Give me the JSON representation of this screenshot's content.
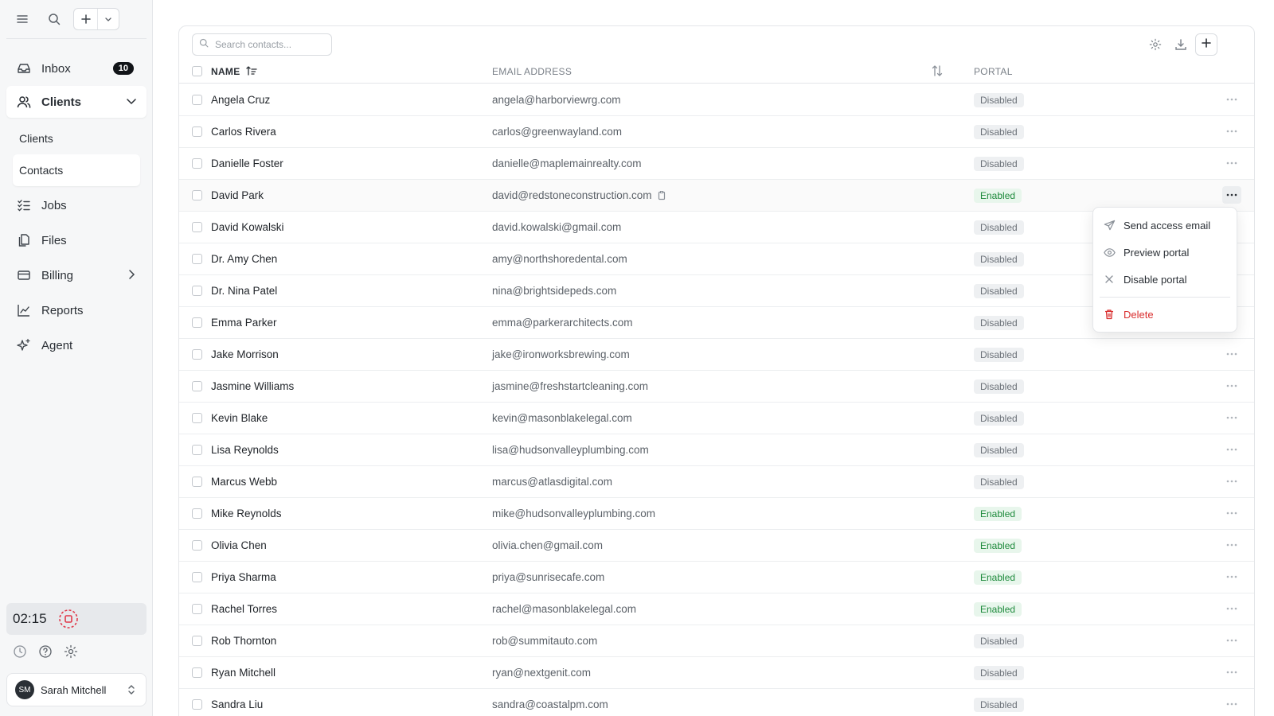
{
  "sidebar": {
    "nav": {
      "inbox": {
        "label": "Inbox",
        "badge": "10"
      },
      "clients": {
        "label": "Clients"
      },
      "clients_sub": {
        "label": "Clients"
      },
      "contacts_sub": {
        "label": "Contacts"
      },
      "jobs": {
        "label": "Jobs"
      },
      "files": {
        "label": "Files"
      },
      "billing": {
        "label": "Billing"
      },
      "reports": {
        "label": "Reports"
      },
      "agent": {
        "label": "Agent"
      }
    },
    "timer": "02:15",
    "user": {
      "initials": "SM",
      "name": "Sarah Mitchell"
    }
  },
  "toolbar": {
    "search_placeholder": "Search contacts..."
  },
  "table": {
    "headers": {
      "name": "NAME",
      "email": "EMAIL ADDRESS",
      "portal": "PORTAL"
    },
    "rows": [
      {
        "name": "Angela Cruz",
        "email": "angela@harborviewrg.com",
        "portal": "Disabled"
      },
      {
        "name": "Carlos Rivera",
        "email": "carlos@greenwayland.com",
        "portal": "Disabled"
      },
      {
        "name": "Danielle Foster",
        "email": "danielle@maplemainrealty.com",
        "portal": "Disabled"
      },
      {
        "name": "David Park",
        "email": "david@redstoneconstruction.com",
        "portal": "Enabled"
      },
      {
        "name": "David Kowalski",
        "email": "david.kowalski@gmail.com",
        "portal": "Disabled"
      },
      {
        "name": "Dr. Amy Chen",
        "email": "amy@northshoredental.com",
        "portal": "Disabled"
      },
      {
        "name": "Dr. Nina Patel",
        "email": "nina@brightsidepeds.com",
        "portal": "Disabled"
      },
      {
        "name": "Emma Parker",
        "email": "emma@parkerarchitects.com",
        "portal": "Disabled"
      },
      {
        "name": "Jake Morrison",
        "email": "jake@ironworksbrewing.com",
        "portal": "Disabled"
      },
      {
        "name": "Jasmine Williams",
        "email": "jasmine@freshstartcleaning.com",
        "portal": "Disabled"
      },
      {
        "name": "Kevin Blake",
        "email": "kevin@masonblakelegal.com",
        "portal": "Disabled"
      },
      {
        "name": "Lisa Reynolds",
        "email": "lisa@hudsonvalleyplumbing.com",
        "portal": "Disabled"
      },
      {
        "name": "Marcus Webb",
        "email": "marcus@atlasdigital.com",
        "portal": "Disabled"
      },
      {
        "name": "Mike Reynolds",
        "email": "mike@hudsonvalleyplumbing.com",
        "portal": "Enabled"
      },
      {
        "name": "Olivia Chen",
        "email": "olivia.chen@gmail.com",
        "portal": "Enabled"
      },
      {
        "name": "Priya Sharma",
        "email": "priya@sunrisecafe.com",
        "portal": "Enabled"
      },
      {
        "name": "Rachel Torres",
        "email": "rachel@masonblakelegal.com",
        "portal": "Enabled"
      },
      {
        "name": "Rob Thornton",
        "email": "rob@summitauto.com",
        "portal": "Disabled"
      },
      {
        "name": "Ryan Mitchell",
        "email": "ryan@nextgenit.com",
        "portal": "Disabled"
      },
      {
        "name": "Sandra Liu",
        "email": "sandra@coastalpm.com",
        "portal": "Disabled"
      }
    ]
  },
  "context_menu": {
    "send_access_email": "Send access email",
    "preview_portal": "Preview portal",
    "disable_portal": "Disable portal",
    "delete": "Delete"
  },
  "colors": {
    "enabled": "#1e8a3c",
    "danger": "#d92d2d",
    "accent_dark": "#111418"
  }
}
